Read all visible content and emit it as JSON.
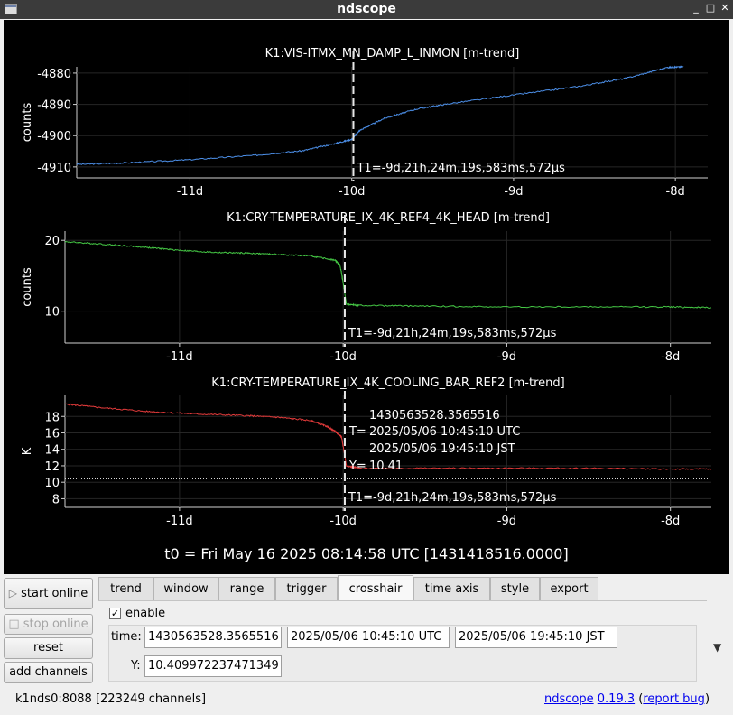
{
  "window": {
    "title": "ndscope"
  },
  "plots": [
    {
      "title": "K1:VIS-ITMX_MN_DAMP_L_INMON [m-trend]",
      "ylabel": "counts",
      "yticks": [
        "-4880",
        "-4890",
        "-4900",
        "-4910"
      ],
      "xticks": [
        "-11d",
        "-10d",
        "-9d",
        "-8d"
      ],
      "cursor_label": "T1=-9d,21h,24m,19s,583ms,572µs",
      "color": "#4c8fe8"
    },
    {
      "title": "K1:CRY-TEMPERATURE_IX_4K_REF4_4K_HEAD [m-trend]",
      "ylabel": "counts",
      "yticks": [
        "20",
        "10"
      ],
      "xticks": [
        "-11d",
        "-10d",
        "-9d",
        "-8d"
      ],
      "cursor_label": "T1=-9d,21h,24m,19s,583ms,572µs",
      "color": "#45c845"
    },
    {
      "title": "K1:CRY-TEMPERATURE_IX_4K_COOLING_BAR_REF2 [m-trend]",
      "ylabel": "K",
      "yticks": [
        "18",
        "16",
        "14",
        "12",
        "10",
        "8"
      ],
      "xticks": [
        "-11d",
        "-10d",
        "-9d",
        "-8d"
      ],
      "cursor_label": "T1=-9d,21h,24m,19s,583ms,572µs",
      "color": "#e23a3a",
      "crosshair": {
        "t_prefix": "T=",
        "t_gps": "1430563528.3565516",
        "t_utc": "2025/05/06 10:45:10 UTC",
        "t_jst": "2025/05/06 19:45:10 JST",
        "y_label": "Y=",
        "y_value": "10.41"
      }
    }
  ],
  "chart_data": [
    {
      "type": "line",
      "title": "K1:VIS-ITMX_MN_DAMP_L_INMON [m-trend]",
      "ylabel": "counts",
      "xticks": [
        "-11d",
        "-10d",
        "-9d",
        "-8d"
      ],
      "xlim": [
        -11.7,
        -7.8
      ],
      "ylim": [
        -4913.5,
        -4878
      ],
      "series": [
        {
          "x": [
            -11.7,
            -11.4,
            -11.0,
            -10.6,
            -10.3,
            -10.1,
            -10.0,
            -9.95,
            -9.8,
            -9.6,
            -9.4,
            -9.0,
            -8.6,
            -8.3,
            -8.05,
            -7.95
          ],
          "y": [
            -4909.2,
            -4908.7,
            -4907.7,
            -4906.3,
            -4904.8,
            -4902.5,
            -4901.2,
            -4898.3,
            -4894.5,
            -4891.5,
            -4889.8,
            -4887.0,
            -4884.3,
            -4881.6,
            -4878.2,
            -4878.0
          ]
        }
      ]
    },
    {
      "type": "line",
      "title": "K1:CRY-TEMPERATURE_IX_4K_REF4_4K_HEAD [m-trend]",
      "ylabel": "counts",
      "xticks": [
        "-11d",
        "-10d",
        "-9d",
        "-8d"
      ],
      "xlim": [
        -11.7,
        -7.75
      ],
      "ylim": [
        5.5,
        21.3
      ],
      "series": [
        {
          "x": [
            -11.7,
            -11.5,
            -11.2,
            -11.0,
            -10.8,
            -10.6,
            -10.4,
            -10.2,
            -10.05,
            -10.02,
            -10.01,
            -9.98,
            -9.9,
            -9.5,
            -9.0,
            -8.5,
            -8.0,
            -7.75
          ],
          "y": [
            19.8,
            19.5,
            19.0,
            18.6,
            18.3,
            18.2,
            18.0,
            17.8,
            17.2,
            16.5,
            15.4,
            11.0,
            10.8,
            10.7,
            10.6,
            10.6,
            10.6,
            10.5
          ]
        }
      ]
    },
    {
      "type": "line",
      "title": "K1:CRY-TEMPERATURE_IX_4K_COOLING_BAR_REF2 [m-trend]",
      "ylabel": "K",
      "xticks": [
        "-11d",
        "-10d",
        "-9d",
        "-8d"
      ],
      "xlim": [
        -11.7,
        -7.75
      ],
      "ylim": [
        6.95,
        20.55
      ],
      "series": [
        {
          "x": [
            -11.7,
            -11.5,
            -11.2,
            -10.9,
            -10.6,
            -10.4,
            -10.2,
            -10.1,
            -10.05,
            -10.01,
            -9.98,
            -9.9,
            -9.5,
            -9.0,
            -8.5,
            -8.0,
            -7.75
          ],
          "y": [
            19.5,
            19.1,
            18.6,
            18.3,
            18.1,
            17.9,
            17.5,
            16.8,
            16.2,
            15.5,
            12.0,
            11.7,
            11.7,
            11.7,
            11.7,
            11.6,
            11.6
          ]
        }
      ],
      "crosshair": {
        "x": -9.99,
        "y": 10.41
      }
    }
  ],
  "t0": "t0 = Fri May 16 2025 08:14:58 UTC [1431418516.0000]",
  "controls": {
    "start_online": "start online",
    "stop_online": "stop online",
    "reset": "reset",
    "add_channels": "add channels",
    "play_icon": "▷",
    "stop_icon": "□"
  },
  "tabs": [
    "trend",
    "window",
    "range",
    "trigger",
    "crosshair",
    "time axis",
    "style",
    "export"
  ],
  "active_tab": "crosshair",
  "crosshair_panel": {
    "enable_label": "enable",
    "enabled": true,
    "time_label": "time:",
    "time_gps": "1430563528.3565516",
    "time_utc": "2025/05/06 10:45:10 UTC",
    "time_jst": "2025/05/06 19:45:10 JST",
    "y_label": "Y:",
    "y_value": "10.409972237471349"
  },
  "status": {
    "server": "k1nds0:8088",
    "channels": "[223249 channels]",
    "app_name": "ndscope",
    "version": "0.19.3",
    "bug_pre": "(",
    "bug_link": "report bug",
    "bug_post": ")"
  }
}
